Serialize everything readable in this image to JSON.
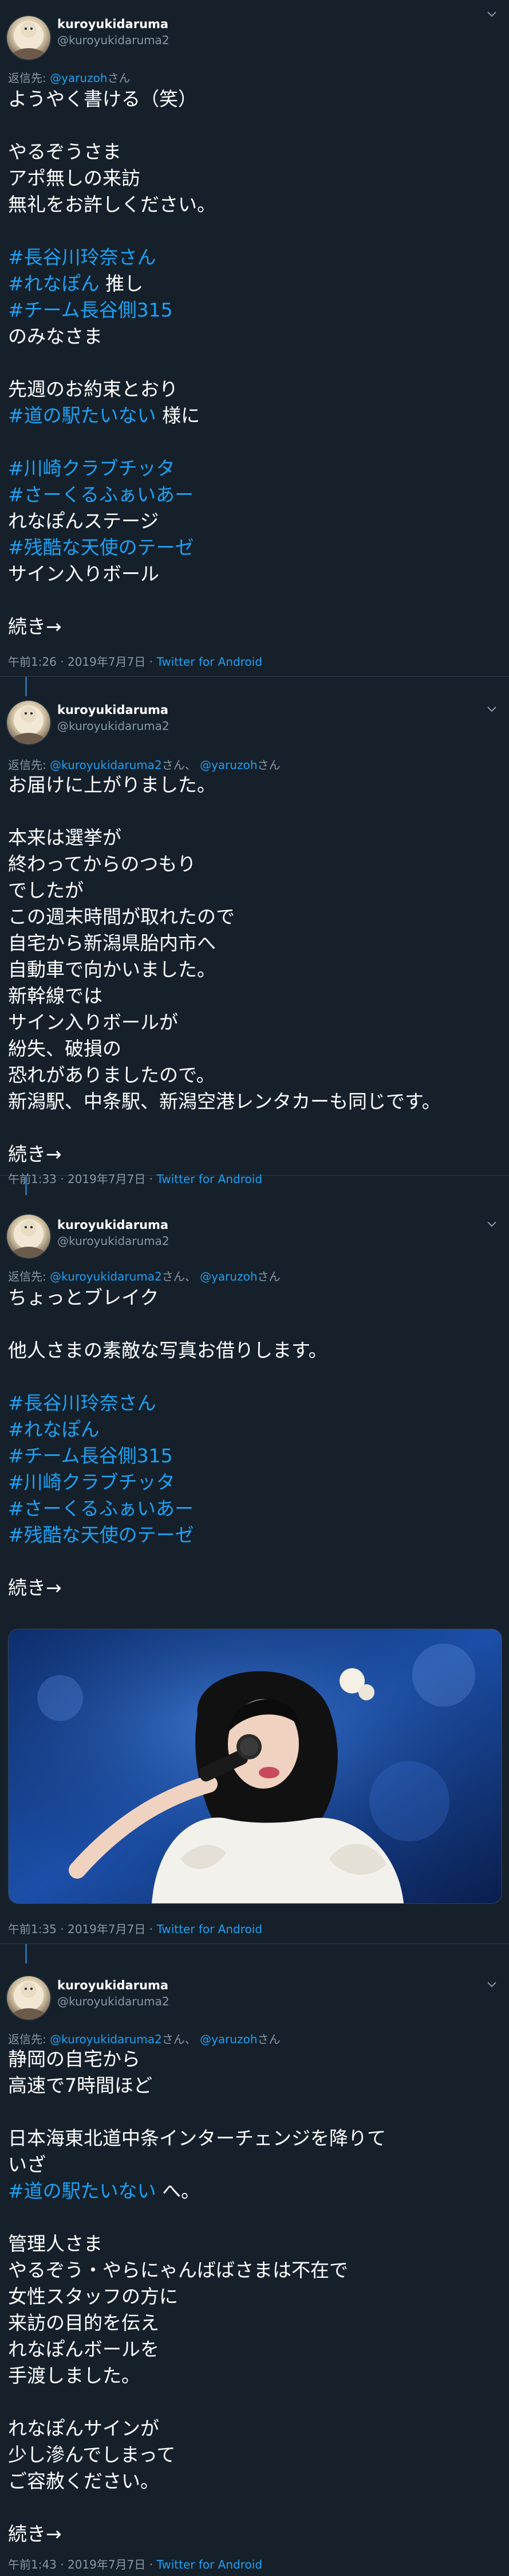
{
  "profile": {
    "display_name": "kuroyukidaruma",
    "handle": "@kuroyukidaruma2"
  },
  "tweets": [
    {
      "reply_label": "返信先:",
      "reply_mentions": [
        "@yaruzoh"
      ],
      "reply_suffixes": [
        "さん"
      ],
      "lines": [
        {
          "t": "ようやく書ける（笑）"
        },
        {
          "t": ""
        },
        {
          "t": "やるぞうさま"
        },
        {
          "t": "アポ無しの来訪"
        },
        {
          "t": "無礼をお許しください。"
        },
        {
          "t": ""
        },
        {
          "t": "#長谷川玲奈さん",
          "tag": true
        },
        {
          "t": "#れなぽん",
          "tag": true,
          "suffix": " 推し"
        },
        {
          "t": "#チーム長谷側315",
          "tag": true
        },
        {
          "t": "のみなさま"
        },
        {
          "t": ""
        },
        {
          "t": "先週のお約束とおり"
        },
        {
          "t": "#道の駅たいない",
          "tag": true,
          "suffix": " 様に"
        },
        {
          "t": ""
        },
        {
          "t": "#川崎クラブチッタ",
          "tag": true
        },
        {
          "t": "#さーくるふぁいあー",
          "tag": true
        },
        {
          "t": "れなぽんステージ"
        },
        {
          "t": "#残酷な天使のテーゼ",
          "tag": true
        },
        {
          "t": "サイン入りボール"
        },
        {
          "t": ""
        },
        {
          "t": "続き→"
        }
      ],
      "time": "午前1:26",
      "date": "2019年7月7日",
      "client": "Twitter for Android"
    },
    {
      "reply_label": "返信先:",
      "reply_mentions": [
        "@kuroyukidaruma2",
        "@yaruzoh"
      ],
      "reply_suffixes": [
        "さん、",
        "さん"
      ],
      "lines": [
        {
          "t": "お届けに上がりました。"
        },
        {
          "t": ""
        },
        {
          "t": "本来は選挙が"
        },
        {
          "t": "終わってからのつもり"
        },
        {
          "t": "でしたが"
        },
        {
          "t": "この週末時間が取れたので"
        },
        {
          "t": "自宅から新潟県胎内市へ"
        },
        {
          "t": "自動車で向かいました。"
        },
        {
          "t": "新幹線では"
        },
        {
          "t": "サイン入りボールが"
        },
        {
          "t": "紛失、破損の"
        },
        {
          "t": "恐れがありましたので。"
        },
        {
          "t": "新潟駅、中条駅、新潟空港レンタカーも同じです。"
        },
        {
          "t": ""
        },
        {
          "t": "続き→"
        }
      ],
      "time": "午前1:33",
      "date": "2019年7月7日",
      "client": "Twitter for Android"
    },
    {
      "reply_label": "返信先:",
      "reply_mentions": [
        "@kuroyukidaruma2",
        "@yaruzoh"
      ],
      "reply_suffixes": [
        "さん、",
        "さん"
      ],
      "lines": [
        {
          "t": "ちょっとブレイク"
        },
        {
          "t": ""
        },
        {
          "t": "他人さまの素敵な写真お借りします。"
        },
        {
          "t": ""
        },
        {
          "t": "#長谷川玲奈さん",
          "tag": true
        },
        {
          "t": "#れなぽん",
          "tag": true
        },
        {
          "t": "#チーム長谷側315",
          "tag": true
        },
        {
          "t": "#川崎クラブチッタ",
          "tag": true
        },
        {
          "t": "#さーくるふぁいあー",
          "tag": true
        },
        {
          "t": "#残酷な天使のテーゼ",
          "tag": true
        },
        {
          "t": ""
        },
        {
          "t": "続き→"
        }
      ],
      "time": "午前1:35",
      "date": "2019年7月7日",
      "client": "Twitter for Android"
    },
    {
      "reply_label": "返信先:",
      "reply_mentions": [
        "@kuroyukidaruma2",
        "@yaruzoh"
      ],
      "reply_suffixes": [
        "さん、",
        "さん"
      ],
      "lines": [
        {
          "t": "静岡の自宅から"
        },
        {
          "t": "高速で7時間ほど"
        },
        {
          "t": ""
        },
        {
          "t": "日本海東北道中条インターチェンジを降りて"
        },
        {
          "t": "いざ"
        },
        {
          "t": "#道の駅たいない",
          "tag": true,
          "suffix": " へ。"
        },
        {
          "t": ""
        },
        {
          "t": "管理人さま"
        },
        {
          "t": "やるぞう・やらにゃんばばさまは不在で"
        },
        {
          "t": "女性スタッフの方に"
        },
        {
          "t": "来訪の目的を伝え"
        },
        {
          "t": "れなぽんボールを"
        },
        {
          "t": "手渡しました。"
        },
        {
          "t": ""
        },
        {
          "t": "れなぽんサインが"
        },
        {
          "t": "少し滲んでしまって"
        },
        {
          "t": "ご容赦ください。"
        },
        {
          "t": ""
        },
        {
          "t": "続き→"
        }
      ],
      "time": "午前1:43",
      "date": "2019年7月7日",
      "client": "Twitter for Android"
    }
  ],
  "meta_separator": "·",
  "colors": {
    "background": "#15202b",
    "text": "#ffffff",
    "muted": "#8899a6",
    "accent": "#1da1f2",
    "thread_line": "#2f6ea5"
  }
}
